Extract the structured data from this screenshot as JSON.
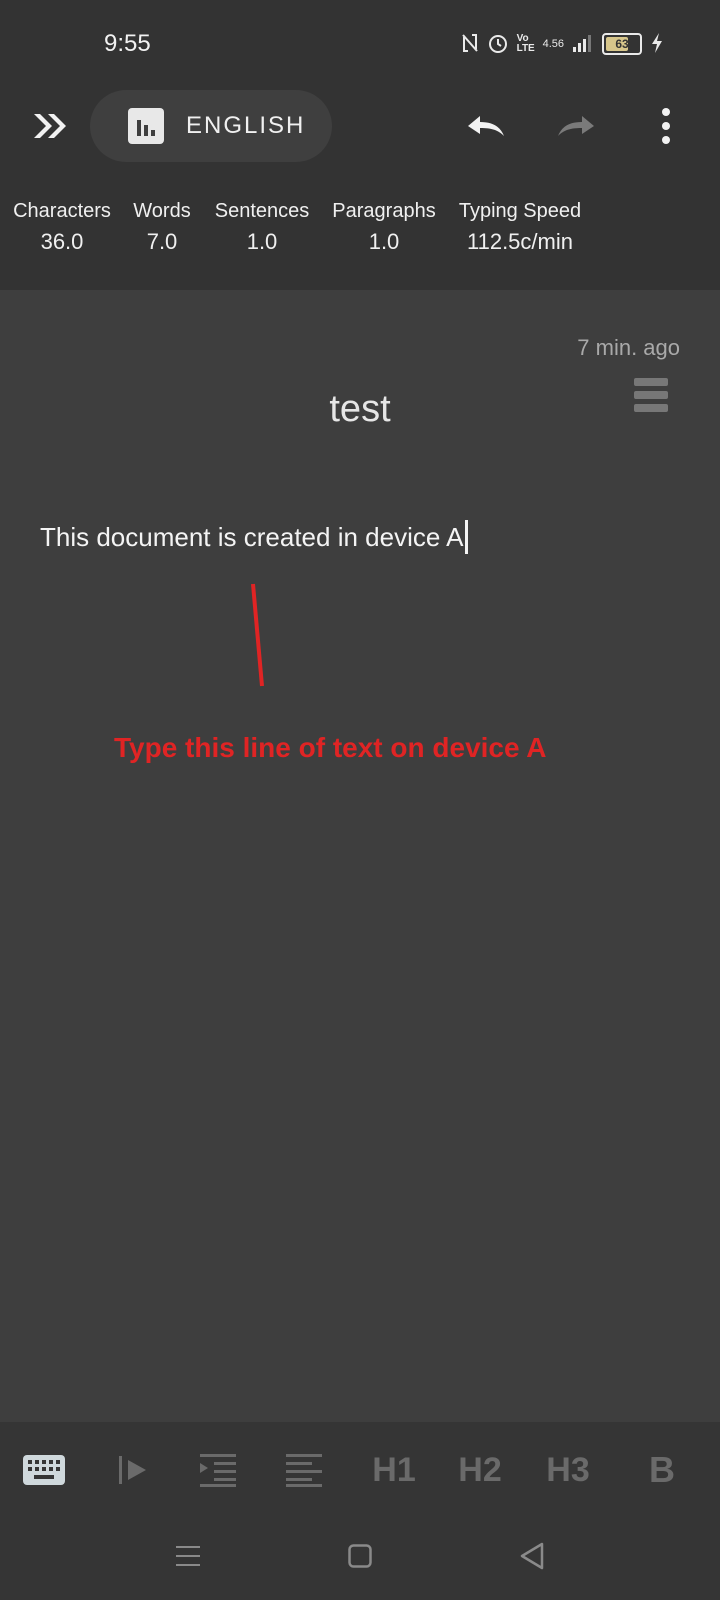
{
  "status": {
    "time": "9:55",
    "battery": "63",
    "signal_text": "4.56",
    "volte": "Vo LTE"
  },
  "toolbar": {
    "language": "ENGLISH"
  },
  "stats": [
    {
      "label": "Characters",
      "value": "36.0"
    },
    {
      "label": "Words",
      "value": "7.0"
    },
    {
      "label": "Sentences",
      "value": "1.0"
    },
    {
      "label": "Paragraphs",
      "value": "1.0"
    },
    {
      "label": "Typing Speed",
      "value": "112.5c/min"
    }
  ],
  "document": {
    "modified": "7 min. ago",
    "title": "test",
    "body": "This document is created in device A"
  },
  "annotation": {
    "text": "Type this line of text on device A",
    "color": "#e02424"
  },
  "format_bar": {
    "h1": "H1",
    "h2": "H2",
    "h3": "H3",
    "bold": "B"
  },
  "colors": {
    "toolbar_bg": "#333333",
    "editor_bg": "#3e3e3e",
    "accent_active": "#cfd8dc"
  }
}
